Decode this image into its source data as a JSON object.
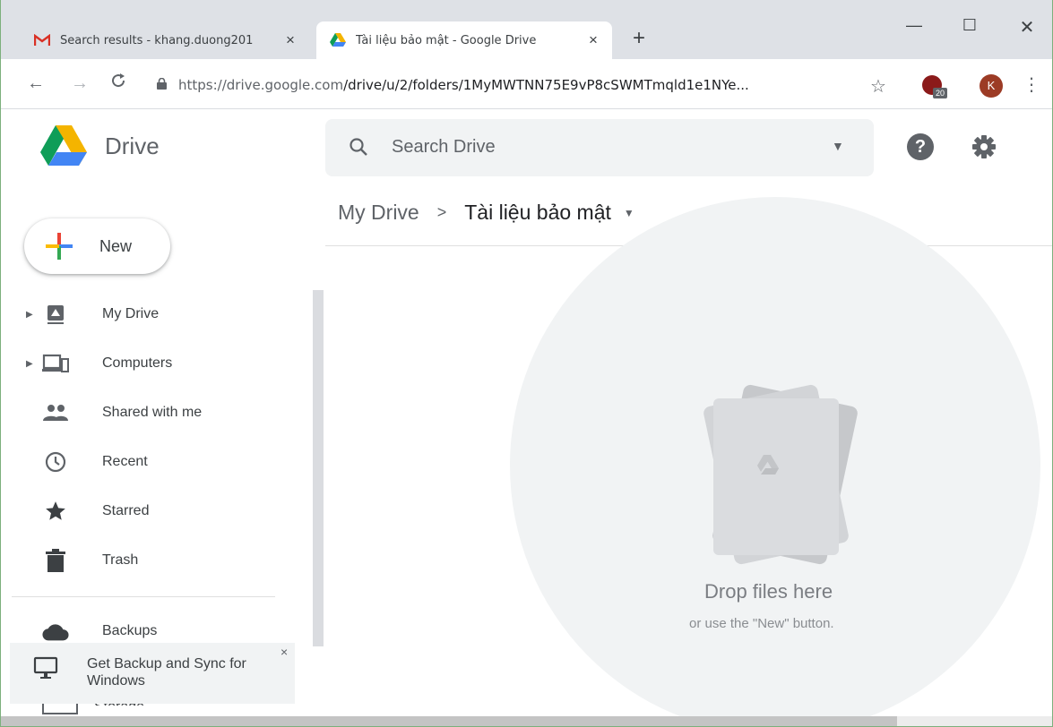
{
  "browser": {
    "tabs": [
      {
        "title": "Search results - khang.duong201",
        "icon": "gmail-icon",
        "close": "×"
      },
      {
        "title": "Tài liệu bảo mật - Google Drive",
        "icon": "google-drive-icon",
        "close": "×"
      }
    ],
    "new_tab": "+",
    "window_controls": {
      "minimize": "—",
      "maximize": "☐",
      "close": "✕"
    },
    "nav": {
      "back": "←",
      "forward": "→",
      "reload": "C"
    },
    "url_host": "https://drive.google.com",
    "url_path": "/drive/u/2/folders/1MyMWTNN75E9vP8cSWMTmqld1e1NYe...",
    "extension_badge": "20",
    "profile_initial": "K",
    "menu": "⋮"
  },
  "drive": {
    "app_name": "Drive",
    "search_placeholder": "Search Drive",
    "new_label": "New",
    "breadcrumb": {
      "root": "My Drive",
      "separator": ">",
      "current": "Tài liệu bảo mật"
    },
    "sidebar": [
      {
        "label": "My Drive",
        "icon": "my-drive-icon",
        "expandable": true
      },
      {
        "label": "Computers",
        "icon": "computers-icon",
        "expandable": true
      },
      {
        "label": "Shared with me",
        "icon": "people-icon",
        "expandable": false
      },
      {
        "label": "Recent",
        "icon": "clock-icon",
        "expandable": false
      },
      {
        "label": "Starred",
        "icon": "star-icon",
        "expandable": false
      },
      {
        "label": "Trash",
        "icon": "trash-icon",
        "expandable": false
      },
      {
        "label": "Backups",
        "icon": "cloud-icon",
        "expandable": false
      }
    ],
    "storage_label": "Storage",
    "promo": {
      "text": "Get Backup and Sync for Windows",
      "close": "×"
    },
    "empty_state": {
      "title": "Drop files here",
      "subtitle": "or use the \"New\" button."
    }
  },
  "colors": {
    "blue": "#4285f4",
    "green": "#0f9d58",
    "yellow": "#f4b400",
    "red": "#db4437"
  }
}
